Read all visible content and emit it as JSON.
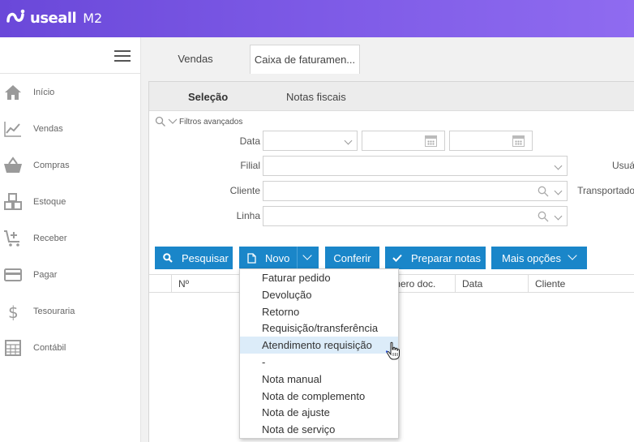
{
  "header": {
    "brand": "useall",
    "product": "M2",
    "colors": {
      "gradient_start": "#6a48d9",
      "gradient_end": "#8f6bf0"
    }
  },
  "sidebar": {
    "menu_icon": "hamburger-icon",
    "items": [
      {
        "label": "Início",
        "icon": "home-icon"
      },
      {
        "label": "Vendas",
        "icon": "chart-line-icon"
      },
      {
        "label": "Compras",
        "icon": "basket-icon"
      },
      {
        "label": "Estoque",
        "icon": "boxes-icon"
      },
      {
        "label": "Receber",
        "icon": "cart-plus-icon"
      },
      {
        "label": "Pagar",
        "icon": "credit-card-icon"
      },
      {
        "label": "Tesouraria",
        "icon": "dollar-icon"
      },
      {
        "label": "Contábil",
        "icon": "calculator-icon"
      }
    ]
  },
  "tabs": [
    {
      "label": "Vendas",
      "active": false
    },
    {
      "label": "Caixa de faturamen...",
      "active": true
    }
  ],
  "subtabs": [
    {
      "label": "Seleção",
      "active": true
    },
    {
      "label": "Notas fiscais",
      "active": false
    }
  ],
  "filters": {
    "advanced_label": "Filtros avançados",
    "data_label": "Data",
    "filial_label": "Filial",
    "cliente_label": "Cliente",
    "linha_label": "Linha",
    "usuario_label": "Usuá",
    "transportadora_label": "Transportado"
  },
  "toolbar": {
    "pesquisar": "Pesquisar",
    "novo": "Novo",
    "conferir": "Conferir",
    "preparar": "Preparar notas",
    "mais": "Mais opções",
    "accent": "#1a86c9"
  },
  "grid": {
    "columns": [
      "Nº",
      "mero doc.",
      "Data",
      "Cliente"
    ]
  },
  "novo_menu": {
    "items": [
      "Faturar pedido",
      "Devolução",
      "Retorno",
      "Requisição/transferência",
      "Atendimento requisição",
      "-",
      "Nota manual",
      "Nota de complemento",
      "Nota de ajuste",
      "Nota de serviço"
    ],
    "highlighted_index": 4
  }
}
